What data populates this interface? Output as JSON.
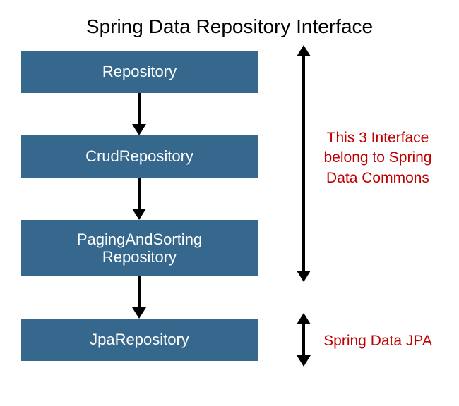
{
  "title": "Spring Data Repository Interface",
  "boxes": {
    "repository": "Repository",
    "crud": "CrudRepository",
    "paging": "PagingAndSorting\nRepository",
    "jpa": "JpaRepository"
  },
  "annotations": {
    "commons": "This 3 Interface\nbelong to Spring\nData Commons",
    "jpa": "Spring Data JPA"
  },
  "colors": {
    "boxFill": "#36688d",
    "boxText": "#ffffff",
    "annotation": "#c00000",
    "arrow": "#000000"
  }
}
